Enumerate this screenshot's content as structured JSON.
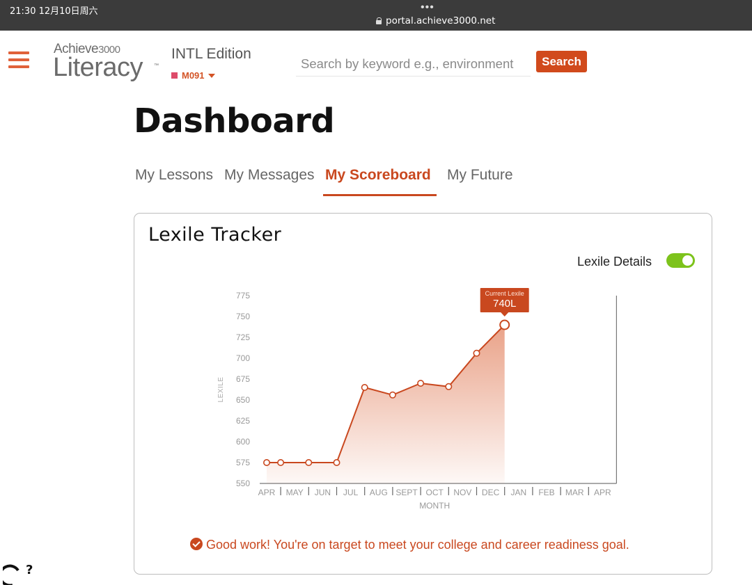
{
  "status_bar": {
    "time": "21:30  12月10日周六",
    "url": "portal.achieve3000.net"
  },
  "header": {
    "logo_top": "Achieve",
    "logo_top_number": "3000",
    "logo_bottom": "Literacy",
    "logo_tm": "™",
    "edition": "INTL Edition",
    "course": "M091",
    "search_placeholder": "Search by keyword e.g., environment",
    "search_label": "Search"
  },
  "page": {
    "title": "Dashboard",
    "tabs": [
      {
        "label": "My Lessons",
        "active": false
      },
      {
        "label": "My Messages",
        "active": false
      },
      {
        "label": "My Scoreboard",
        "active": true
      },
      {
        "label": "My Future",
        "active": false
      }
    ]
  },
  "card": {
    "title": "Lexile Tracker",
    "toggle_label": "Lexile Details",
    "toggle_on": true,
    "message": "Good work! You're on target to meet your college and career readiness goal."
  },
  "colors": {
    "accent": "#c9481f",
    "toggle": "#7dc31c",
    "course_marker": "#dd4b6a"
  },
  "chart_data": {
    "type": "area",
    "ylabel": "LEXILE",
    "xlabel": "MONTH",
    "ylim": [
      550,
      775
    ],
    "yticks": [
      775,
      750,
      725,
      700,
      675,
      650,
      625,
      600,
      575,
      550
    ],
    "categories": [
      "APR",
      "MAY",
      "JUN",
      "JUL",
      "AUG",
      "SEPT",
      "OCT",
      "NOV",
      "DEC",
      "JAN",
      "FEB",
      "MAR",
      "APR"
    ],
    "points": [
      {
        "x": 0,
        "y": 575
      },
      {
        "x": 0.5,
        "y": 575
      },
      {
        "x": 1.5,
        "y": 575
      },
      {
        "x": 2.5,
        "y": 575
      },
      {
        "x": 3.5,
        "y": 665
      },
      {
        "x": 4.5,
        "y": 656
      },
      {
        "x": 5.5,
        "y": 670
      },
      {
        "x": 6.5,
        "y": 666
      },
      {
        "x": 7.5,
        "y": 706
      },
      {
        "x": 8.5,
        "y": 740
      }
    ],
    "callout": {
      "label": "Current Lexile",
      "value": "740L"
    }
  }
}
